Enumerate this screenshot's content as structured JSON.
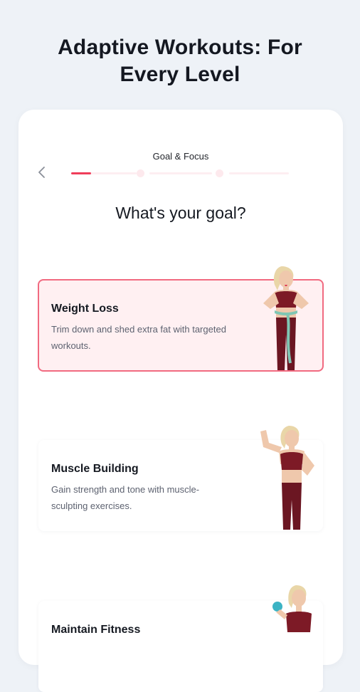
{
  "headline": {
    "line1": "Adaptive Workouts: For",
    "line2": "Every Level"
  },
  "header": {
    "step_title": "Goal & Focus",
    "back_icon": "chevron-left-icon"
  },
  "progress": {
    "current_step": 1,
    "total_steps": 3,
    "fill": 0.3
  },
  "question": "What's your goal?",
  "options": [
    {
      "title": "Weight Loss",
      "description": "Trim down and shed extra fat with targeted workouts.",
      "selected": true
    },
    {
      "title": "Muscle Building",
      "description": "Gain strength and tone with muscle-sculpting exercises.",
      "selected": false
    },
    {
      "title": "Maintain Fitness",
      "description": "",
      "selected": false
    }
  ],
  "colors": {
    "accent": "#ef3d5a",
    "selected_bg": "#fff0f2",
    "page_bg": "#eef2f7"
  }
}
